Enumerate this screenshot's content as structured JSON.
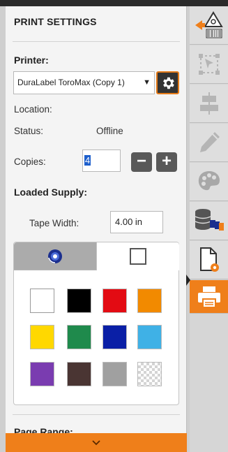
{
  "panel": {
    "title": "PRINT SETTINGS",
    "printer_label": "Printer:",
    "printer_selected": "DuraLabel ToroMax (Copy 1)",
    "location_label": "Location:",
    "location_value": "",
    "status_label": "Status:",
    "status_value": "Offline",
    "copies_label": "Copies:",
    "copies_value": "4",
    "minus_label": "−",
    "plus_label": "+",
    "loaded_supply_label": "Loaded Supply:",
    "tape_width_label": "Tape Width:",
    "tape_width_value": "4.00 in",
    "page_range_label": "Page Range:"
  },
  "supply_tabs": [
    {
      "name": "roll",
      "icon": "tape-roll-icon"
    },
    {
      "name": "blank",
      "icon": "blank-square-icon"
    }
  ],
  "swatch_colors": [
    "#ffffff",
    "#000000",
    "#e30b13",
    "#f28a00",
    "#ffd800",
    "#1f8a4c",
    "#0a1fa6",
    "#3fb1e6",
    "#7a3cb0",
    "#4a3533",
    "#a0a0a0",
    "transparent"
  ],
  "colors": {
    "accent": "#ef7f1a",
    "panel_bg": "#f4f4f4",
    "toolbar_bg": "#d6d6d6"
  },
  "toolbar_icons": [
    "hazard-barcode-icon",
    "select-shape-icon",
    "align-center-icon",
    "pencil-icon",
    "palette-icon",
    "database-icon",
    "document-settings-icon",
    "printer-icon"
  ]
}
